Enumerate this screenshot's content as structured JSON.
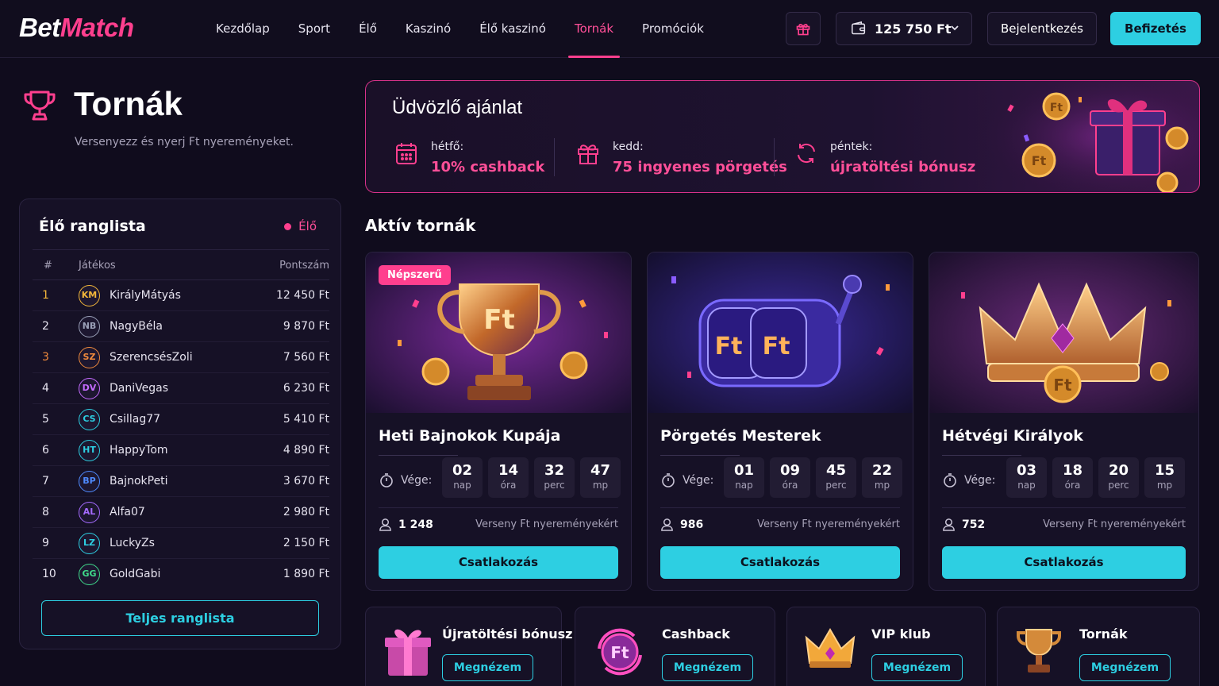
{
  "header": {
    "logo": {
      "part1": "Bet",
      "part2": "Match"
    },
    "nav": [
      "Kezdőlap",
      "Sport",
      "Élő",
      "Kaszinó",
      "Élő kaszinó",
      "Tornák",
      "Promóciók"
    ],
    "active_nav": "Tornák",
    "balance": "125 750 Ft",
    "login_label": "Bejelentkezés",
    "deposit_label": "Befizetés"
  },
  "page": {
    "title": "Tornák",
    "subtitle": "Versenyezz és nyerj Ft nyereményeket."
  },
  "leaderboard": {
    "title": "Élő ranglista",
    "live_label": "Élő",
    "columns": {
      "rank": "#",
      "player": "Játékos",
      "score": "Pontszám"
    },
    "rows": [
      {
        "rank": "1",
        "initials": "KM",
        "name": "KirályMátyás",
        "score": "12 450 Ft",
        "color": "#f2b63a"
      },
      {
        "rank": "2",
        "initials": "NB",
        "name": "NagyBéla",
        "score": "9 870 Ft",
        "color": "#9aa0b8"
      },
      {
        "rank": "3",
        "initials": "SZ",
        "name": "SzerencsésZoli",
        "score": "7 560 Ft",
        "color": "#f08a3c"
      },
      {
        "rank": "4",
        "initials": "DV",
        "name": "DaniVegas",
        "score": "6 230 Ft",
        "color": "#c56bff"
      },
      {
        "rank": "5",
        "initials": "CS",
        "name": "Csillag77",
        "score": "5 410 Ft",
        "color": "#2dcfe2"
      },
      {
        "rank": "6",
        "initials": "HT",
        "name": "HappyTom",
        "score": "4 890 Ft",
        "color": "#2dcfe2"
      },
      {
        "rank": "7",
        "initials": "BP",
        "name": "BajnokPeti",
        "score": "3 670 Ft",
        "color": "#4f8bff"
      },
      {
        "rank": "8",
        "initials": "AL",
        "name": "Alfa07",
        "score": "2 980 Ft",
        "color": "#a56bff"
      },
      {
        "rank": "9",
        "initials": "LZ",
        "name": "LuckyZs",
        "score": "2 150 Ft",
        "color": "#2dcfe2"
      },
      {
        "rank": "10",
        "initials": "GG",
        "name": "GoldGabi",
        "score": "1 890 Ft",
        "color": "#3fd98a"
      }
    ],
    "full_label": "Teljes ranglista"
  },
  "banner": {
    "title": "Üdvözlő ajánlat",
    "offers": [
      {
        "day": "hétfő:",
        "value": "10% cashback",
        "icon": "calendar-icon"
      },
      {
        "day": "kedd:",
        "value": "75 ingyenes pörgetés",
        "icon": "gift-icon"
      },
      {
        "day": "péntek:",
        "value": "újratöltési bónusz",
        "icon": "refresh-icon"
      }
    ]
  },
  "tournaments": {
    "section_title": "Aktív tornák",
    "ends_label": "Vége:",
    "join_label": "Csatlakozás",
    "cards": [
      {
        "badge": "Népszerű",
        "title": "Heti Bajnokok Kupája",
        "players": "1 248",
        "prize": "Verseny Ft nyereményekért",
        "countdown": [
          {
            "n": "02",
            "u": "nap"
          },
          {
            "n": "14",
            "u": "óra"
          },
          {
            "n": "32",
            "u": "perc"
          },
          {
            "n": "47",
            "u": "mp"
          }
        ]
      },
      {
        "badge": "",
        "title": "Pörgetés Mesterek",
        "players": "986",
        "prize": "Verseny Ft nyereményekért",
        "countdown": [
          {
            "n": "01",
            "u": "nap"
          },
          {
            "n": "09",
            "u": "óra"
          },
          {
            "n": "45",
            "u": "perc"
          },
          {
            "n": "22",
            "u": "mp"
          }
        ]
      },
      {
        "badge": "",
        "title": "Hétvégi Királyok",
        "players": "752",
        "prize": "Verseny Ft nyereményekért",
        "countdown": [
          {
            "n": "03",
            "u": "nap"
          },
          {
            "n": "18",
            "u": "óra"
          },
          {
            "n": "20",
            "u": "perc"
          },
          {
            "n": "15",
            "u": "mp"
          }
        ]
      }
    ]
  },
  "promos": [
    {
      "title": "Újratöltési bónusz",
      "button": "Megnézem",
      "icon": "gift-box-icon"
    },
    {
      "title": "Cashback",
      "button": "Megnézem",
      "icon": "ft-coin-icon"
    },
    {
      "title": "VIP klub",
      "button": "Megnézem",
      "icon": "crown-icon"
    },
    {
      "title": "Tornák",
      "button": "Megnézem",
      "icon": "trophy-icon"
    }
  ],
  "colors": {
    "accent_pink": "#ff3f8e",
    "accent_cyan": "#2dcfe2",
    "background": "#100c1d",
    "panel": "#161126"
  }
}
